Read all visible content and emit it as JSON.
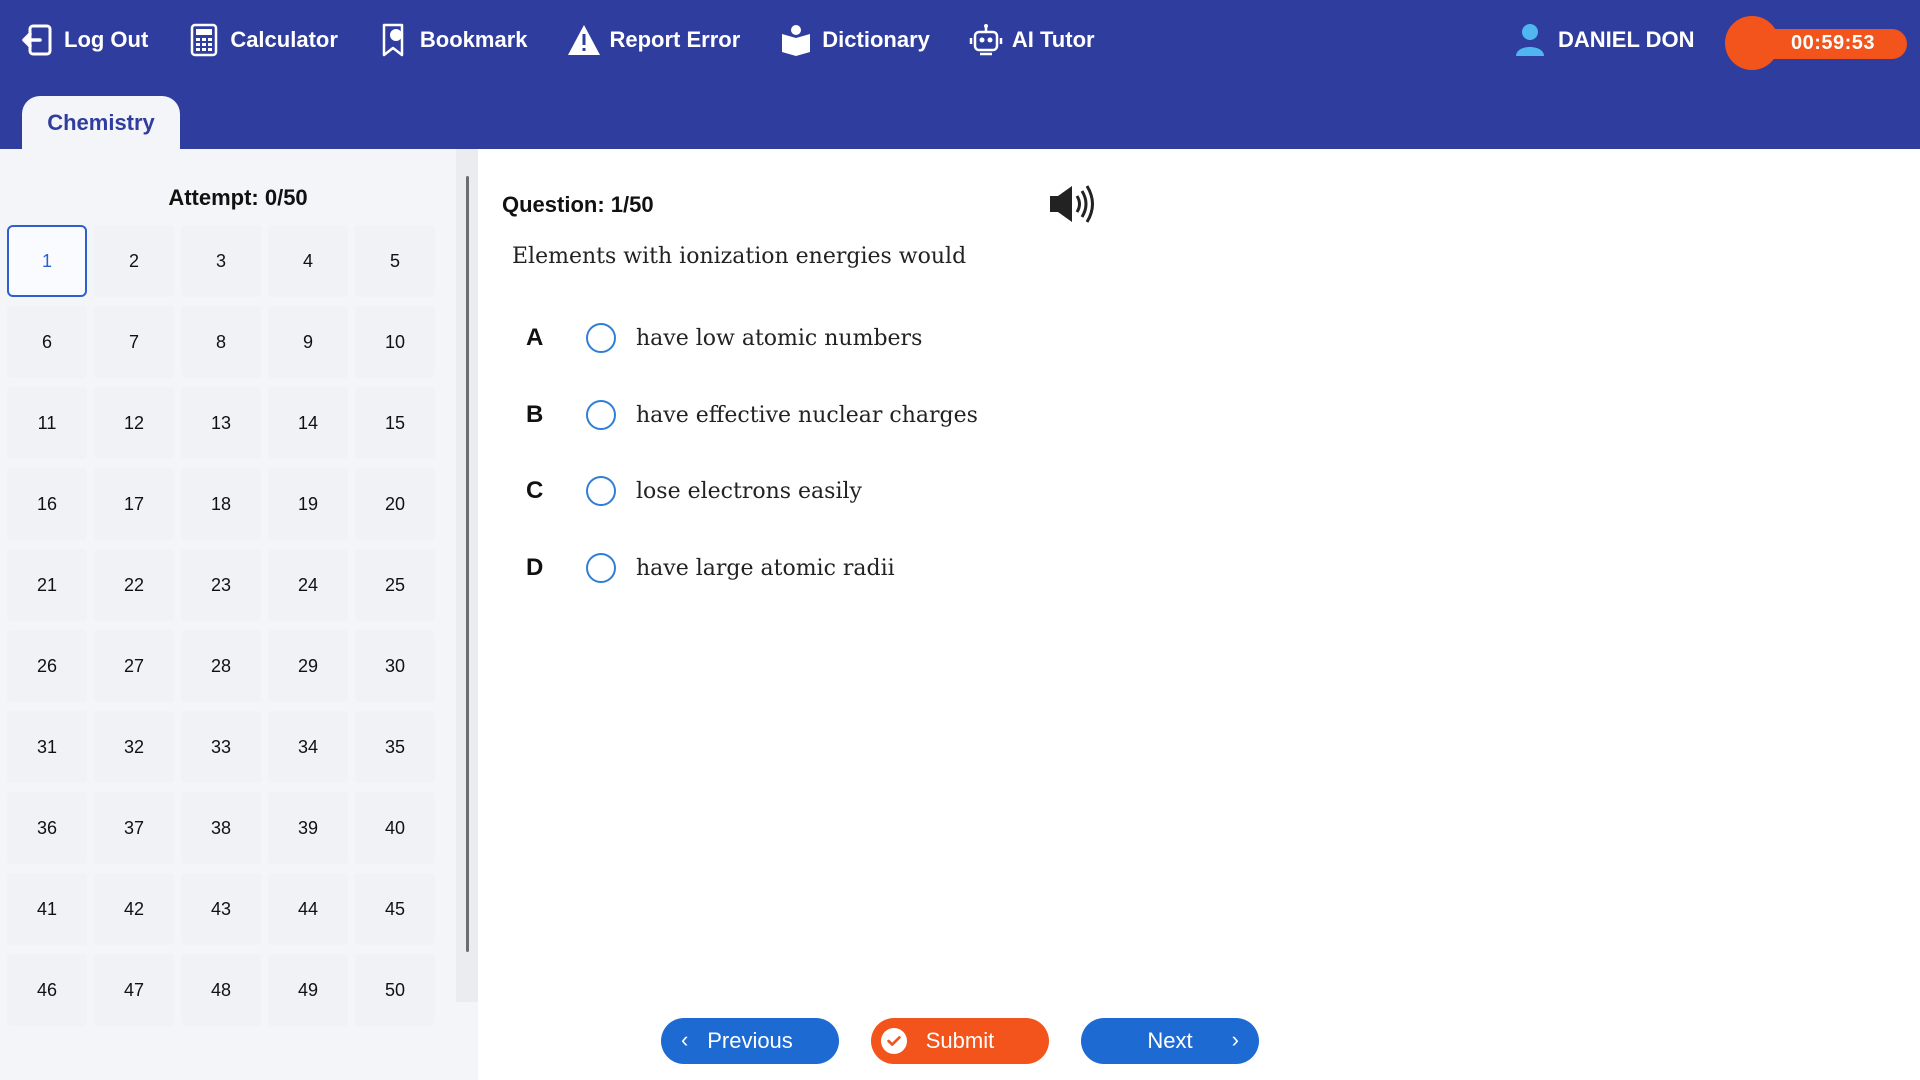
{
  "toolbar": {
    "items": [
      {
        "label": "Log Out",
        "icon": "logout-icon"
      },
      {
        "label": "Calculator",
        "icon": "calculator-icon"
      },
      {
        "label": "Bookmark",
        "icon": "bookmark-icon"
      },
      {
        "label": "Report Error",
        "icon": "warning-icon"
      },
      {
        "label": "Dictionary",
        "icon": "book-icon"
      },
      {
        "label": "AI Tutor",
        "icon": "robot-icon"
      }
    ],
    "user_name": "DANIEL DON",
    "timer": "00:59:53"
  },
  "tab": {
    "label": "Chemistry"
  },
  "navigator": {
    "attempt": "Attempt: 0/50",
    "current": 1,
    "numbers": [
      "1",
      "2",
      "3",
      "4",
      "5",
      "6",
      "7",
      "8",
      "9",
      "10",
      "11",
      "12",
      "13",
      "14",
      "15",
      "16",
      "17",
      "18",
      "19",
      "20",
      "21",
      "22",
      "23",
      "24",
      "25",
      "26",
      "27",
      "28",
      "29",
      "30",
      "31",
      "32",
      "33",
      "34",
      "35",
      "36",
      "37",
      "38",
      "39",
      "40",
      "41",
      "42",
      "43",
      "44",
      "45",
      "46",
      "47",
      "48",
      "49",
      "50"
    ]
  },
  "question": {
    "number_label": "Question: 1/50",
    "text": "Elements with ionization energies would",
    "options": [
      {
        "letter": "A",
        "text": "have low atomic numbers"
      },
      {
        "letter": "B",
        "text": "have effective nuclear charges"
      },
      {
        "letter": "C",
        "text": "lose electrons easily"
      },
      {
        "letter": "D",
        "text": "have large atomic radii"
      }
    ]
  },
  "footer": {
    "previous_label": "Previous",
    "submit_label": "Submit",
    "next_label": "Next"
  },
  "colors": {
    "header": "#2f3d9e",
    "accent_blue": "#1e6ad3",
    "accent_orange": "#f2541b"
  }
}
